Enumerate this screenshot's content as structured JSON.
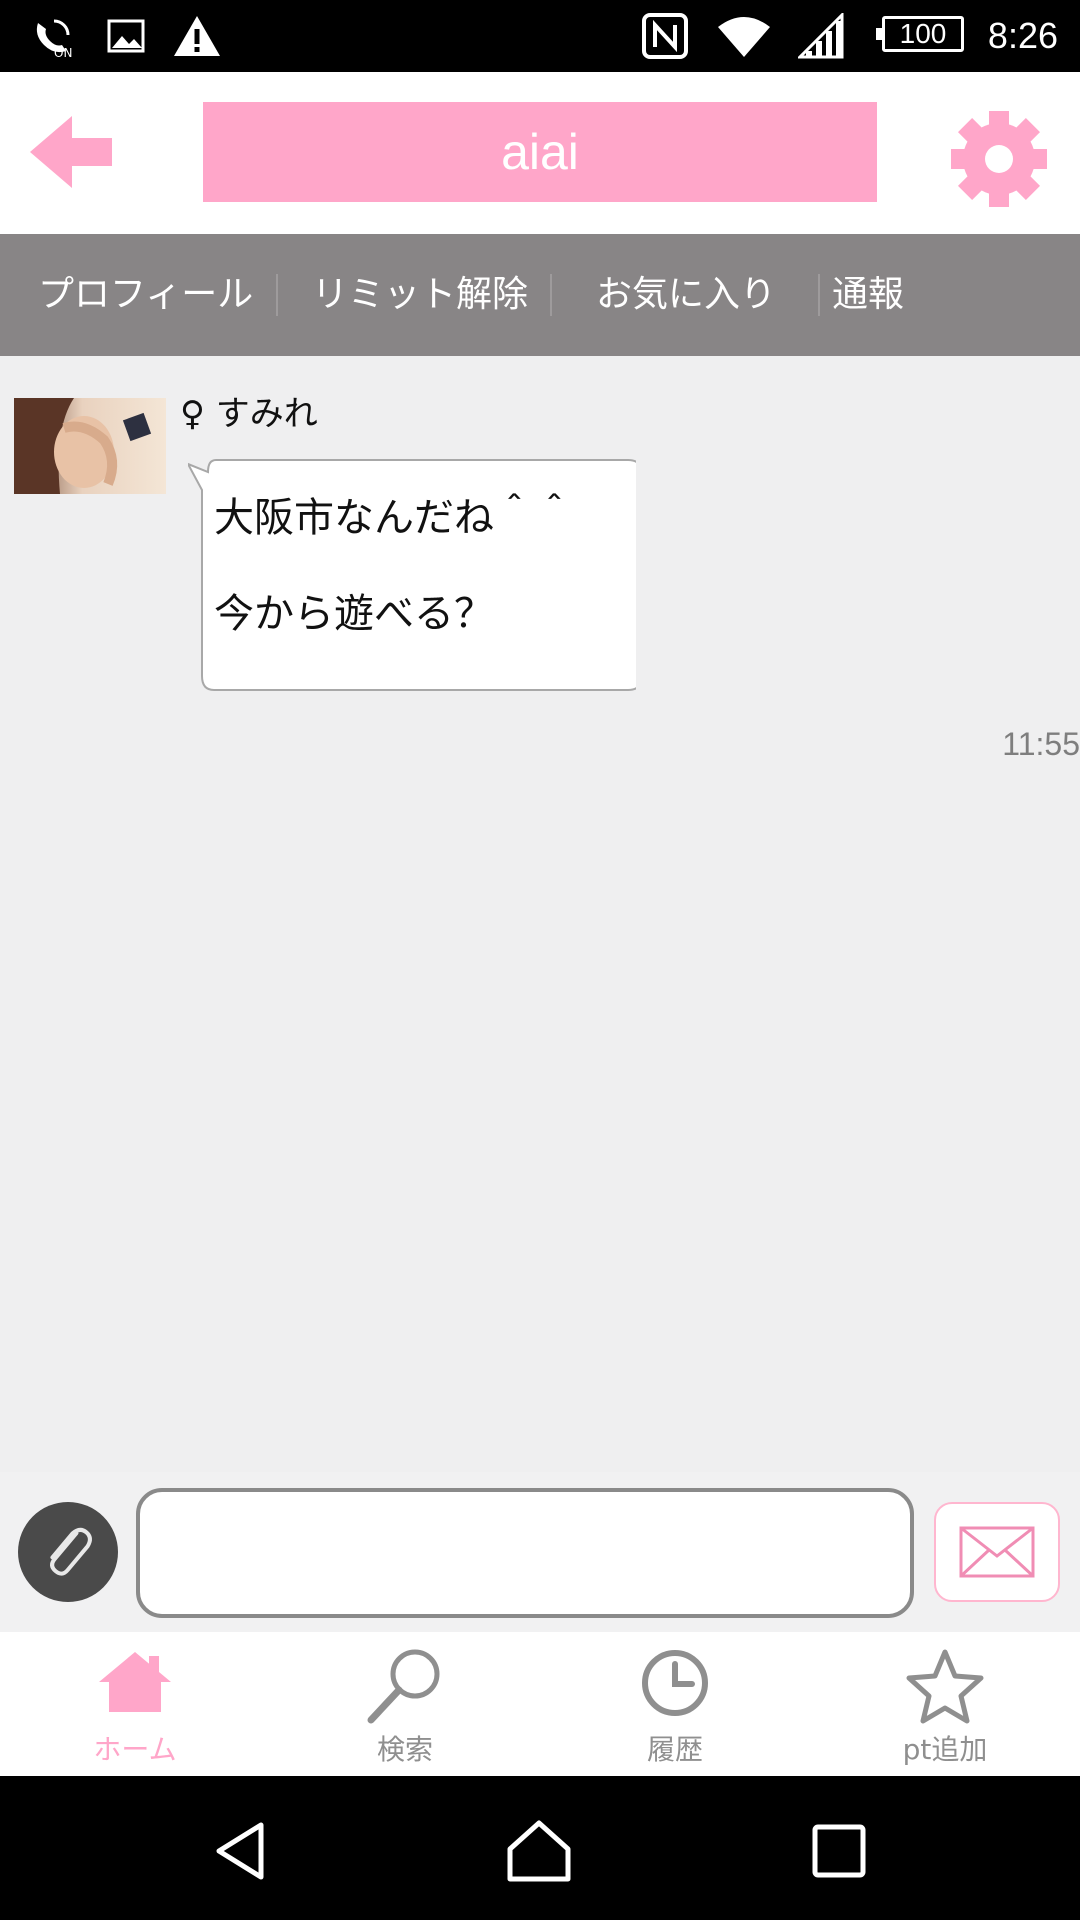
{
  "status_bar": {
    "time": "8:26",
    "battery": "100",
    "icons": [
      "nfc-call-on-icon",
      "image-icon",
      "warning-icon",
      "nfc-icon",
      "wifi-icon",
      "signal-icon"
    ]
  },
  "header": {
    "title": "aiai",
    "back_icon": "back-arrow-icon",
    "settings_icon": "gear-icon",
    "accent_color": "#ffa6c9"
  },
  "tabs": [
    {
      "label": "プロフィール"
    },
    {
      "label": "リミット解除"
    },
    {
      "label": "お気に入り"
    },
    {
      "label": "通報"
    }
  ],
  "chat": {
    "sender_name": "♀ すみれ",
    "message_text": "大阪市なんだね＾＾\n今から遊べる？",
    "message_time": "11:55"
  },
  "composer": {
    "attach_icon": "paperclip-icon",
    "input_value": "",
    "send_icon": "envelope-icon"
  },
  "bottom_nav": [
    {
      "label": "ホーム",
      "icon": "home-icon",
      "active": true
    },
    {
      "label": "検索",
      "icon": "search-icon",
      "active": false
    },
    {
      "label": "履歴",
      "icon": "clock-icon",
      "active": false
    },
    {
      "label": "pt追加",
      "icon": "star-icon",
      "active": false
    }
  ],
  "system_nav": [
    "back-icon",
    "home-icon",
    "recents-icon"
  ]
}
